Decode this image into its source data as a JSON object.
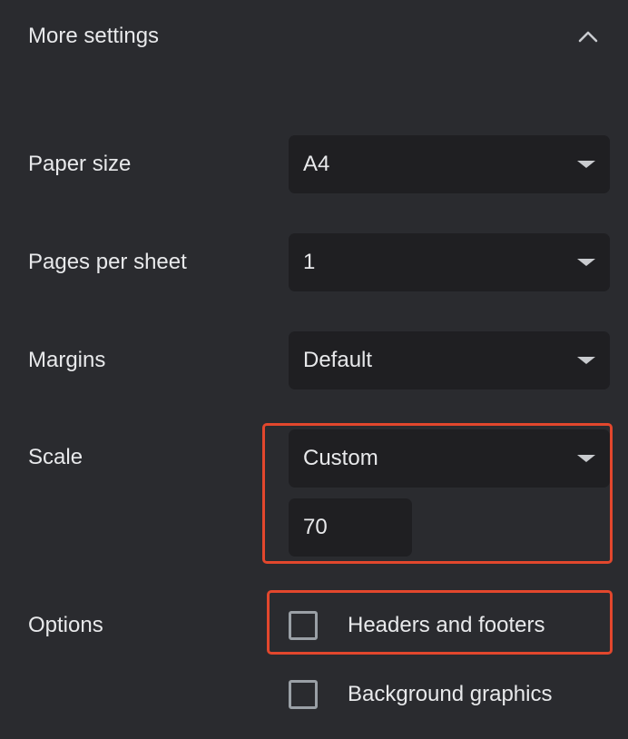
{
  "section": {
    "title": "More settings",
    "collapse_icon": "chevron-up-icon"
  },
  "paper_size": {
    "label": "Paper size",
    "value": "A4"
  },
  "pages_per_sheet": {
    "label": "Pages per sheet",
    "value": "1"
  },
  "margins": {
    "label": "Margins",
    "value": "Default"
  },
  "scale": {
    "label": "Scale",
    "mode": "Custom",
    "custom_value": "70"
  },
  "options": {
    "label": "Options",
    "items": [
      {
        "label": "Headers and footers",
        "checked": false
      },
      {
        "label": "Background graphics",
        "checked": false
      }
    ]
  },
  "colors": {
    "background": "#2a2b2f",
    "control_background": "#1f1f22",
    "highlight": "#e2472d",
    "text": "#e8e9eb"
  }
}
